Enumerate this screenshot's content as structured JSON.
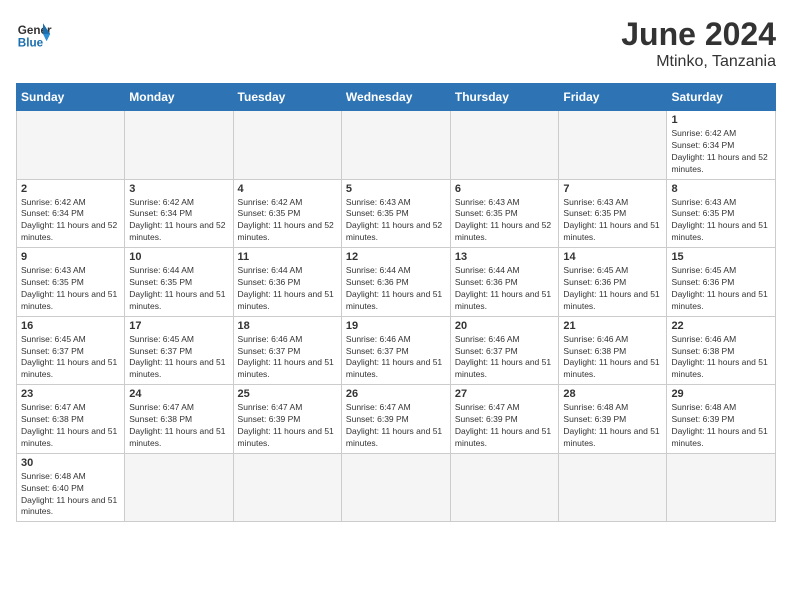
{
  "header": {
    "logo_general": "General",
    "logo_blue": "Blue",
    "month_year": "June 2024",
    "location": "Mtinko, Tanzania"
  },
  "days_of_week": [
    "Sunday",
    "Monday",
    "Tuesday",
    "Wednesday",
    "Thursday",
    "Friday",
    "Saturday"
  ],
  "weeks": [
    [
      {
        "day": "",
        "sunrise": "",
        "sunset": "",
        "daylight": ""
      },
      {
        "day": "",
        "sunrise": "",
        "sunset": "",
        "daylight": ""
      },
      {
        "day": "",
        "sunrise": "",
        "sunset": "",
        "daylight": ""
      },
      {
        "day": "",
        "sunrise": "",
        "sunset": "",
        "daylight": ""
      },
      {
        "day": "",
        "sunrise": "",
        "sunset": "",
        "daylight": ""
      },
      {
        "day": "",
        "sunrise": "",
        "sunset": "",
        "daylight": ""
      },
      {
        "day": "1",
        "sunrise": "Sunrise: 6:42 AM",
        "sunset": "Sunset: 6:34 PM",
        "daylight": "Daylight: 11 hours and 52 minutes."
      }
    ],
    [
      {
        "day": "2",
        "sunrise": "Sunrise: 6:42 AM",
        "sunset": "Sunset: 6:34 PM",
        "daylight": "Daylight: 11 hours and 52 minutes."
      },
      {
        "day": "3",
        "sunrise": "Sunrise: 6:42 AM",
        "sunset": "Sunset: 6:34 PM",
        "daylight": "Daylight: 11 hours and 52 minutes."
      },
      {
        "day": "4",
        "sunrise": "Sunrise: 6:42 AM",
        "sunset": "Sunset: 6:35 PM",
        "daylight": "Daylight: 11 hours and 52 minutes."
      },
      {
        "day": "5",
        "sunrise": "Sunrise: 6:43 AM",
        "sunset": "Sunset: 6:35 PM",
        "daylight": "Daylight: 11 hours and 52 minutes."
      },
      {
        "day": "6",
        "sunrise": "Sunrise: 6:43 AM",
        "sunset": "Sunset: 6:35 PM",
        "daylight": "Daylight: 11 hours and 52 minutes."
      },
      {
        "day": "7",
        "sunrise": "Sunrise: 6:43 AM",
        "sunset": "Sunset: 6:35 PM",
        "daylight": "Daylight: 11 hours and 51 minutes."
      },
      {
        "day": "8",
        "sunrise": "Sunrise: 6:43 AM",
        "sunset": "Sunset: 6:35 PM",
        "daylight": "Daylight: 11 hours and 51 minutes."
      }
    ],
    [
      {
        "day": "9",
        "sunrise": "Sunrise: 6:43 AM",
        "sunset": "Sunset: 6:35 PM",
        "daylight": "Daylight: 11 hours and 51 minutes."
      },
      {
        "day": "10",
        "sunrise": "Sunrise: 6:44 AM",
        "sunset": "Sunset: 6:35 PM",
        "daylight": "Daylight: 11 hours and 51 minutes."
      },
      {
        "day": "11",
        "sunrise": "Sunrise: 6:44 AM",
        "sunset": "Sunset: 6:36 PM",
        "daylight": "Daylight: 11 hours and 51 minutes."
      },
      {
        "day": "12",
        "sunrise": "Sunrise: 6:44 AM",
        "sunset": "Sunset: 6:36 PM",
        "daylight": "Daylight: 11 hours and 51 minutes."
      },
      {
        "day": "13",
        "sunrise": "Sunrise: 6:44 AM",
        "sunset": "Sunset: 6:36 PM",
        "daylight": "Daylight: 11 hours and 51 minutes."
      },
      {
        "day": "14",
        "sunrise": "Sunrise: 6:45 AM",
        "sunset": "Sunset: 6:36 PM",
        "daylight": "Daylight: 11 hours and 51 minutes."
      },
      {
        "day": "15",
        "sunrise": "Sunrise: 6:45 AM",
        "sunset": "Sunset: 6:36 PM",
        "daylight": "Daylight: 11 hours and 51 minutes."
      }
    ],
    [
      {
        "day": "16",
        "sunrise": "Sunrise: 6:45 AM",
        "sunset": "Sunset: 6:37 PM",
        "daylight": "Daylight: 11 hours and 51 minutes."
      },
      {
        "day": "17",
        "sunrise": "Sunrise: 6:45 AM",
        "sunset": "Sunset: 6:37 PM",
        "daylight": "Daylight: 11 hours and 51 minutes."
      },
      {
        "day": "18",
        "sunrise": "Sunrise: 6:46 AM",
        "sunset": "Sunset: 6:37 PM",
        "daylight": "Daylight: 11 hours and 51 minutes."
      },
      {
        "day": "19",
        "sunrise": "Sunrise: 6:46 AM",
        "sunset": "Sunset: 6:37 PM",
        "daylight": "Daylight: 11 hours and 51 minutes."
      },
      {
        "day": "20",
        "sunrise": "Sunrise: 6:46 AM",
        "sunset": "Sunset: 6:37 PM",
        "daylight": "Daylight: 11 hours and 51 minutes."
      },
      {
        "day": "21",
        "sunrise": "Sunrise: 6:46 AM",
        "sunset": "Sunset: 6:38 PM",
        "daylight": "Daylight: 11 hours and 51 minutes."
      },
      {
        "day": "22",
        "sunrise": "Sunrise: 6:46 AM",
        "sunset": "Sunset: 6:38 PM",
        "daylight": "Daylight: 11 hours and 51 minutes."
      }
    ],
    [
      {
        "day": "23",
        "sunrise": "Sunrise: 6:47 AM",
        "sunset": "Sunset: 6:38 PM",
        "daylight": "Daylight: 11 hours and 51 minutes."
      },
      {
        "day": "24",
        "sunrise": "Sunrise: 6:47 AM",
        "sunset": "Sunset: 6:38 PM",
        "daylight": "Daylight: 11 hours and 51 minutes."
      },
      {
        "day": "25",
        "sunrise": "Sunrise: 6:47 AM",
        "sunset": "Sunset: 6:39 PM",
        "daylight": "Daylight: 11 hours and 51 minutes."
      },
      {
        "day": "26",
        "sunrise": "Sunrise: 6:47 AM",
        "sunset": "Sunset: 6:39 PM",
        "daylight": "Daylight: 11 hours and 51 minutes."
      },
      {
        "day": "27",
        "sunrise": "Sunrise: 6:47 AM",
        "sunset": "Sunset: 6:39 PM",
        "daylight": "Daylight: 11 hours and 51 minutes."
      },
      {
        "day": "28",
        "sunrise": "Sunrise: 6:48 AM",
        "sunset": "Sunset: 6:39 PM",
        "daylight": "Daylight: 11 hours and 51 minutes."
      },
      {
        "day": "29",
        "sunrise": "Sunrise: 6:48 AM",
        "sunset": "Sunset: 6:39 PM",
        "daylight": "Daylight: 11 hours and 51 minutes."
      }
    ],
    [
      {
        "day": "30",
        "sunrise": "Sunrise: 6:48 AM",
        "sunset": "Sunset: 6:40 PM",
        "daylight": "Daylight: 11 hours and 51 minutes."
      },
      {
        "day": "",
        "sunrise": "",
        "sunset": "",
        "daylight": ""
      },
      {
        "day": "",
        "sunrise": "",
        "sunset": "",
        "daylight": ""
      },
      {
        "day": "",
        "sunrise": "",
        "sunset": "",
        "daylight": ""
      },
      {
        "day": "",
        "sunrise": "",
        "sunset": "",
        "daylight": ""
      },
      {
        "day": "",
        "sunrise": "",
        "sunset": "",
        "daylight": ""
      },
      {
        "day": "",
        "sunrise": "",
        "sunset": "",
        "daylight": ""
      }
    ]
  ]
}
